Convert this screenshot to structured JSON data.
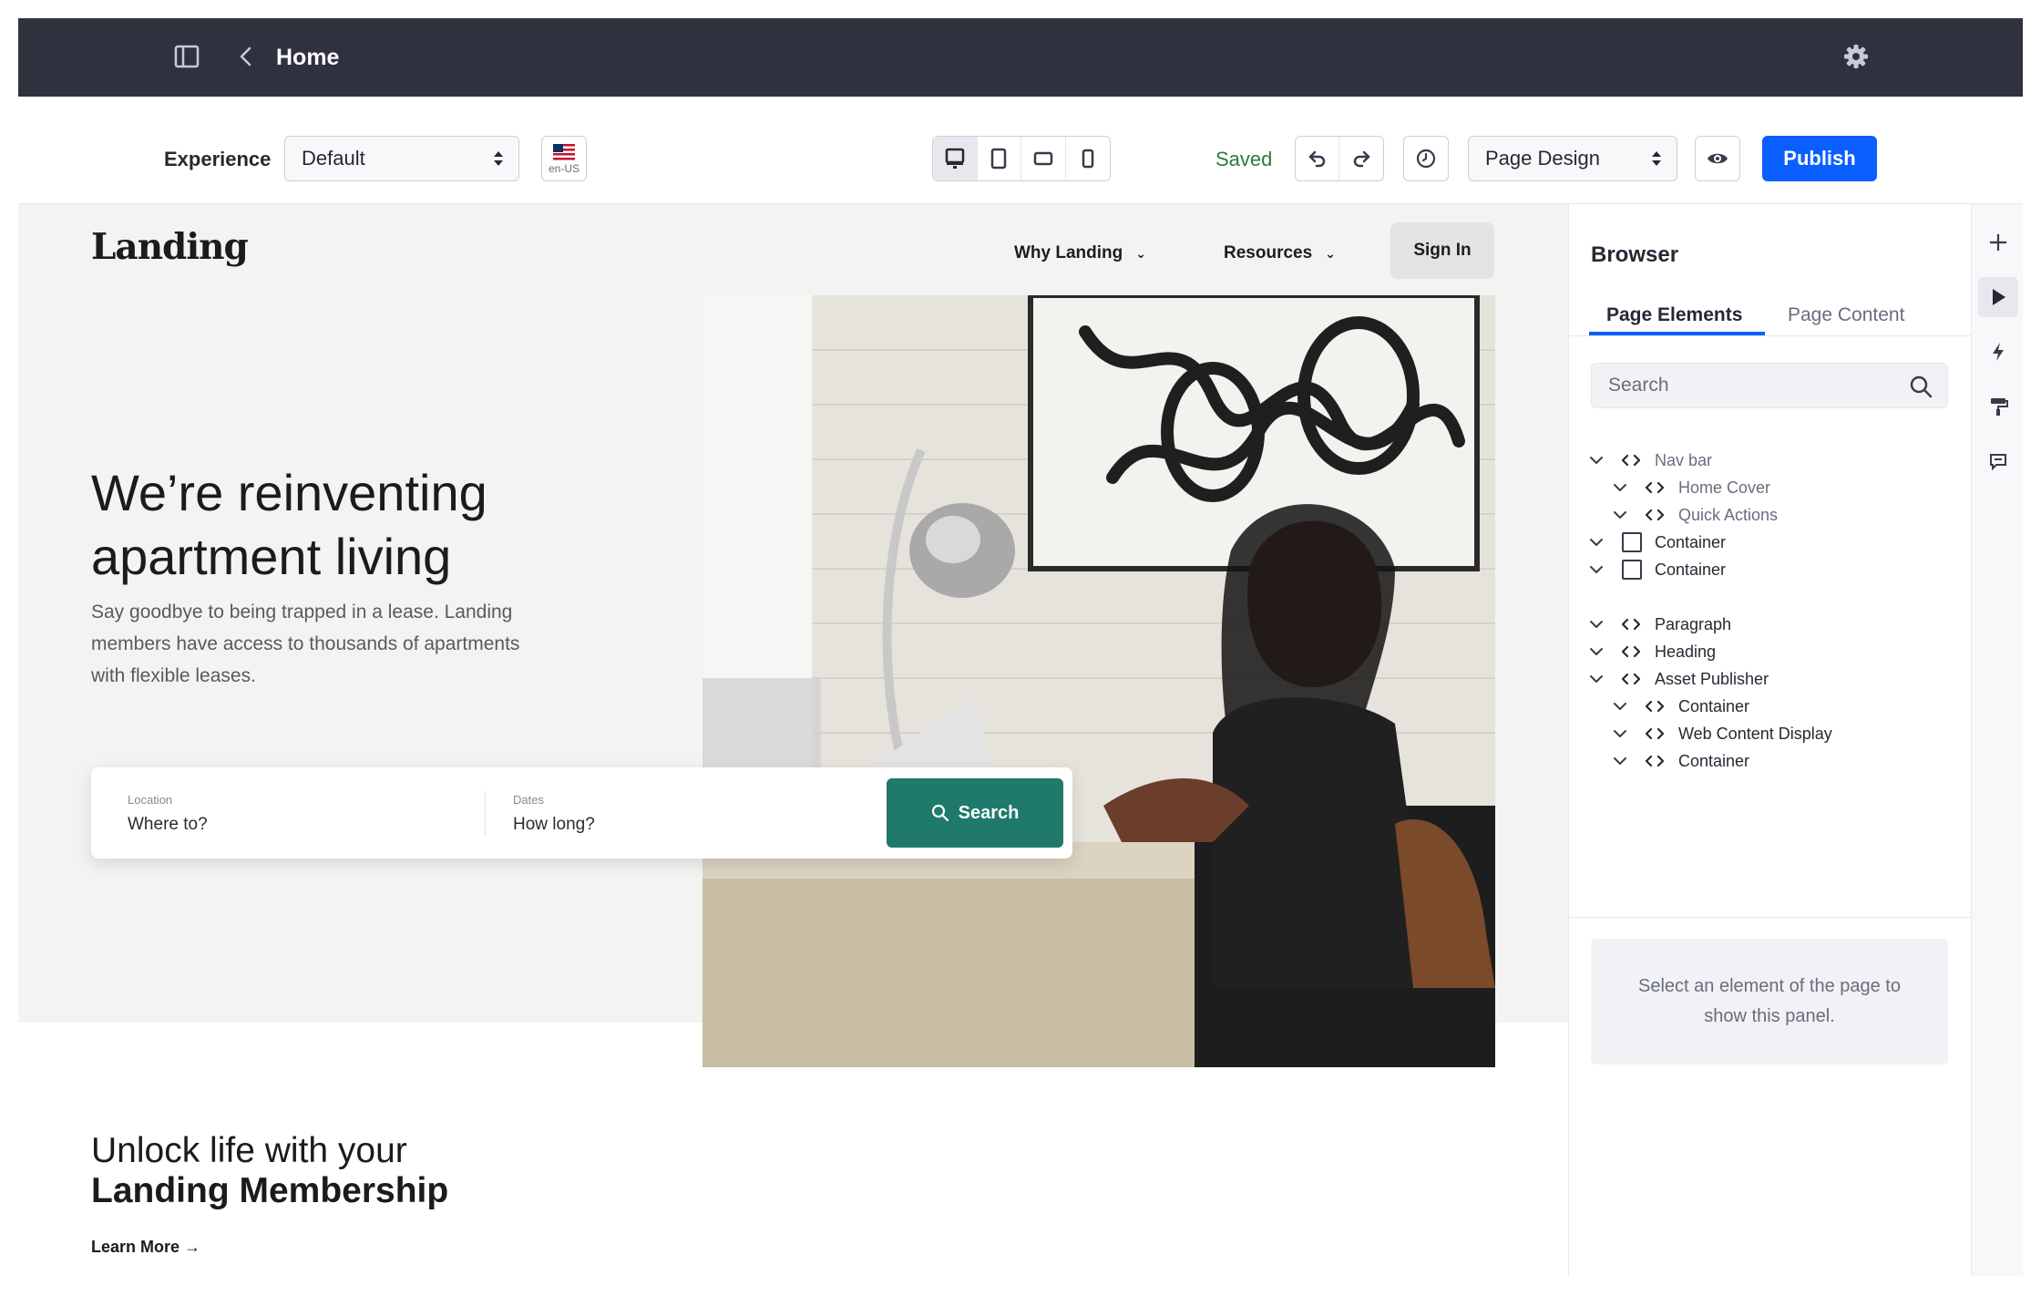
{
  "topbar": {
    "title": "Home"
  },
  "toolbar": {
    "experience_label": "Experience",
    "experience_value": "Default",
    "language_code": "en-US",
    "saved_text": "Saved",
    "mode_value": "Page Design",
    "publish_label": "Publish"
  },
  "page": {
    "logo": "Landing",
    "nav": {
      "why": "Why Landing",
      "resources": "Resources",
      "signin": "Sign In"
    },
    "hero_heading_line1": "We’re reinventing",
    "hero_heading_line2": "apartment living",
    "hero_paragraph": "Say goodbye to being trapped in a lease. Landing members have access to thousands of apartments with flexible leases.",
    "search": {
      "location_label": "Location",
      "location_placeholder": "Where to?",
      "dates_label": "Dates",
      "dates_placeholder": "How long?",
      "button_label": "Search"
    },
    "unlock_line1": "Unlock life with your",
    "unlock_line2": "Landing Membership",
    "learn_more": "Learn More →"
  },
  "panel": {
    "title": "Browser",
    "tabs": [
      "Page Elements",
      "Page Content"
    ],
    "search_placeholder": "Search",
    "tree": [
      {
        "label": "Nav bar",
        "icon": "code",
        "level": 0,
        "muted": true
      },
      {
        "label": "Home Cover",
        "icon": "code",
        "level": 1,
        "muted": true
      },
      {
        "label": "Quick Actions",
        "icon": "code",
        "level": 1,
        "muted": true
      },
      {
        "label": "Container",
        "icon": "square",
        "level": 0,
        "muted": false
      },
      {
        "label": "Container",
        "icon": "square",
        "level": 0,
        "muted": false
      },
      {
        "label": "Paragraph",
        "icon": "code",
        "level": 0,
        "muted": false
      },
      {
        "label": "Heading",
        "icon": "code",
        "level": 0,
        "muted": false
      },
      {
        "label": "Asset Publisher",
        "icon": "code",
        "level": 0,
        "muted": false
      },
      {
        "label": "Container",
        "icon": "code",
        "level": 1,
        "muted": false
      },
      {
        "label": "Web Content Display",
        "icon": "code",
        "level": 1,
        "muted": false
      },
      {
        "label": "Container",
        "icon": "code",
        "level": 1,
        "muted": false
      }
    ],
    "empty_message": "Select an element of the page to show this panel."
  },
  "colors": {
    "topbar": "#30313f",
    "accent": "#0b5fff",
    "saved": "#287d3c",
    "search_button": "#1f7a6b"
  }
}
